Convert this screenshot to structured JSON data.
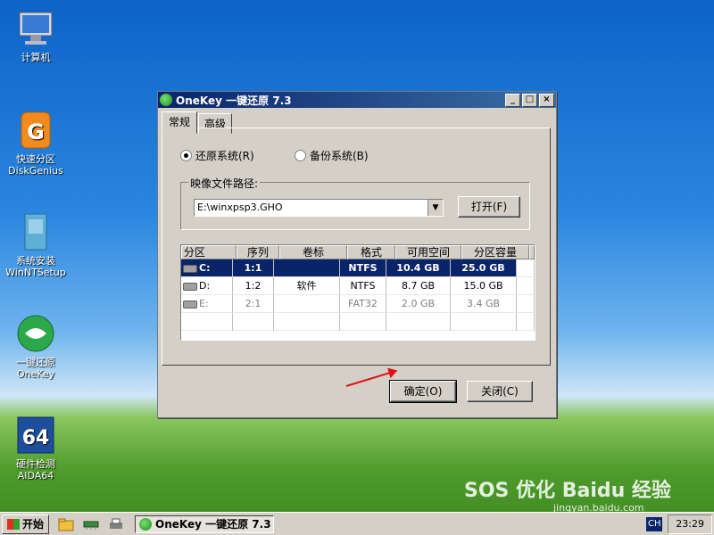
{
  "desktop": {
    "icons": [
      {
        "label": "计算机"
      },
      {
        "label": "快速分区",
        "label2": "DiskGenius"
      },
      {
        "label": "系统安装",
        "label2": "WinNTSetup"
      },
      {
        "label": "一键还原",
        "label2": "OneKey"
      },
      {
        "label": "硬件检测",
        "label2": "AIDA64"
      }
    ]
  },
  "window": {
    "title": "OneKey 一键还原 7.3",
    "min_btn": "_",
    "max_btn": "□",
    "close_btn": "×",
    "tabs": [
      "常规",
      "高级"
    ],
    "radio_restore": "还原系统(R)",
    "radio_backup": "备份系统(B)",
    "image_path_label": "映像文件路径:",
    "image_path_value": "E:\\winxpsp3.GHO",
    "open_button": "打开(F)",
    "table": {
      "headers": [
        "分区",
        "序列",
        "卷标",
        "格式",
        "可用空间",
        "分区容量"
      ],
      "rows": [
        {
          "drive": "C:",
          "seq": "1:1",
          "label": "",
          "fs": "NTFS",
          "free": "10.4 GB",
          "size": "25.0 GB",
          "selected": true
        },
        {
          "drive": "D:",
          "seq": "1:2",
          "label": "软件",
          "fs": "NTFS",
          "free": "8.7 GB",
          "size": "15.0 GB",
          "selected": false
        },
        {
          "drive": "E:",
          "seq": "2:1",
          "label": "",
          "fs": "FAT32",
          "free": "2.0 GB",
          "size": "3.4 GB",
          "selected": false
        }
      ]
    },
    "ok_button": "确定(O)",
    "close_button": "关闭(C)"
  },
  "taskbar": {
    "start_label": "开始",
    "task_label": "OneKey 一键还原 7.3",
    "ime": "CH",
    "clock": "23:29"
  },
  "watermark": {
    "line1": "SOS 优化 Baidu 经验",
    "line2": "jingyan.baidu.com"
  }
}
